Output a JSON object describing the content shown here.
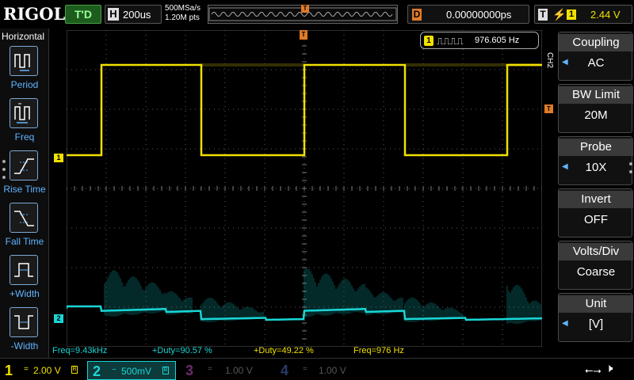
{
  "topbar": {
    "logo": "RIGOL",
    "run_state": "T'D",
    "horizontal": {
      "badge": "H",
      "timebase": "200us"
    },
    "sample_rate": "500MSa/s",
    "memory_points": "1.20M pts",
    "trigger_position_badge": "T",
    "delay": {
      "badge": "D",
      "value": "0.00000000ps"
    },
    "trigger": {
      "badge": "T",
      "edge_icon": "rising-edge-icon",
      "source": "1",
      "level": "2.44 V"
    }
  },
  "left_menu": {
    "title": "Horizontal",
    "items": [
      {
        "label": "Period",
        "icon": "period-icon"
      },
      {
        "label": "Freq",
        "icon": "freq-icon"
      },
      {
        "label": "Rise Time",
        "icon": "rise-time-icon"
      },
      {
        "label": "Fall Time",
        "icon": "fall-time-icon"
      },
      {
        "label": "+Width",
        "icon": "positive-width-icon"
      },
      {
        "label": "-Width",
        "icon": "negative-width-icon"
      }
    ]
  },
  "screen": {
    "ch1_marker": "1",
    "ch2_marker": "2",
    "trigger_marker": "T",
    "freq_counter": {
      "channel": "1",
      "value": "976.605 Hz"
    },
    "measurements": [
      {
        "label": "Freq=9.43kHz",
        "color": "#1ad6d6"
      },
      {
        "label": "+Duty=90.57 %",
        "color": "#1ad6d6"
      },
      {
        "label": "+Duty=49.22 %",
        "color": "#f0e000"
      },
      {
        "label": "Freq=976 Hz",
        "color": "#f0e000"
      }
    ]
  },
  "right_menu": {
    "channel_tag": "CH2",
    "items": [
      {
        "title": "Coupling",
        "value": "AC",
        "has_arrow": true
      },
      {
        "title": "BW Limit",
        "value": "20M",
        "has_arrow": false
      },
      {
        "title": "Probe",
        "value": "10X",
        "has_arrow": true
      },
      {
        "title": "Invert",
        "value": "OFF",
        "has_arrow": false
      },
      {
        "title": "Volts/Div",
        "value": "Coarse",
        "has_arrow": false
      },
      {
        "title": "Unit",
        "value": "[V]",
        "has_arrow": true
      }
    ]
  },
  "bottom_bar": {
    "channels": [
      {
        "num": "1",
        "coupling": "=",
        "scale": "2.00 V",
        "bw": "B",
        "color": "#f0e000",
        "active": true
      },
      {
        "num": "2",
        "coupling": "~",
        "scale": "500mV",
        "bw": "B",
        "color": "#1ad6d6",
        "active": true
      },
      {
        "num": "3",
        "coupling": "=",
        "scale": "1.00 V",
        "bw": "",
        "color": "#6a2a6a",
        "active": false
      },
      {
        "num": "4",
        "coupling": "=",
        "scale": "1.00 V",
        "bw": "",
        "color": "#2a3a6a",
        "active": false
      }
    ],
    "usb_icon": "usb-icon",
    "speaker_icon": "speaker-muted-icon"
  },
  "colors": {
    "ch1": "#f0e000",
    "ch2": "#1ad6d6",
    "trigger": "#e07a28",
    "menu_accent": "#5fb4ff",
    "grid": "#555555"
  }
}
